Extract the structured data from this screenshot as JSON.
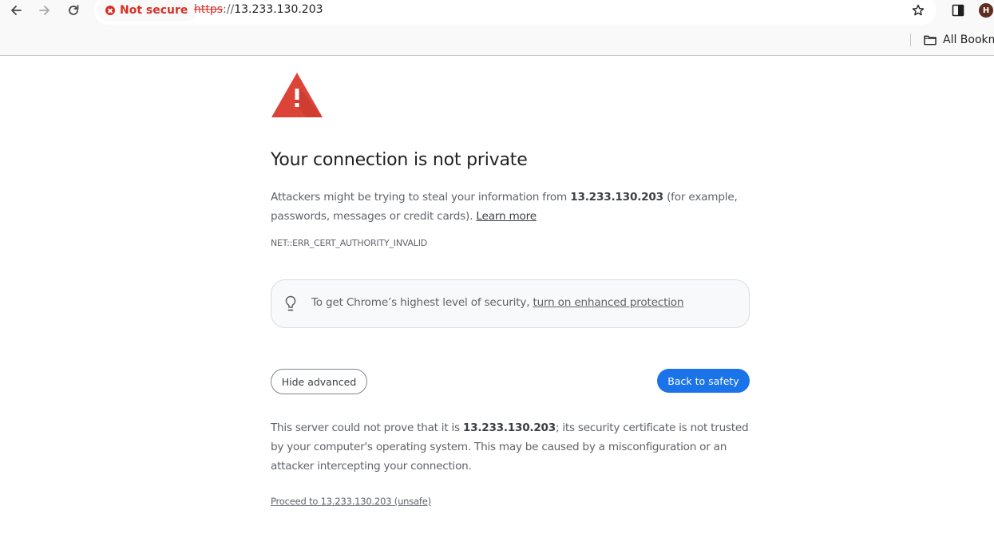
{
  "browser": {
    "nav": {
      "back_icon": "arrow-left-icon",
      "forward_icon": "arrow-right-icon",
      "reload_icon": "reload-icon"
    },
    "omnibox": {
      "security_label": "Not secure",
      "security_icon": "error-circle-icon",
      "url_scheme": "https",
      "url_separator": "://",
      "url_host": "13.233.130.203"
    },
    "actions": {
      "bookmark_icon": "star-icon",
      "side_panel_icon": "side-panel-icon",
      "profile_initial": "H"
    },
    "bookmarks_bar": {
      "folder_label": "All Bookmarks"
    },
    "colors": {
      "error": "#d93025",
      "primary": "#1a73e8",
      "avatar": "#5d2e1f"
    }
  },
  "interstitial": {
    "icon": "warning-triangle-icon",
    "title": "Your connection is not private",
    "explanation": {
      "prefix": "Attackers might be trying to steal your information from ",
      "host": "13.233.130.203",
      "suffix": " (for example, passwords, messages or credit cards). ",
      "learn_more": "Learn more"
    },
    "error_code": "NET::ERR_CERT_AUTHORITY_INVALID",
    "enhanced_protection": {
      "icon": "lightbulb-icon",
      "text": "To get Chrome’s highest level of security, ",
      "link": "turn on enhanced protection"
    },
    "buttons": {
      "hide_advanced": "Hide advanced",
      "back_to_safety": "Back to safety"
    },
    "details": {
      "prefix": "This server could not prove that it is ",
      "host": "13.233.130.203",
      "suffix": "; its security certificate is not trusted by your computer's operating system. This may be caused by a misconfiguration or an attacker intercepting your connection."
    },
    "proceed_link": "Proceed to 13.233.130.203 (unsafe)"
  }
}
